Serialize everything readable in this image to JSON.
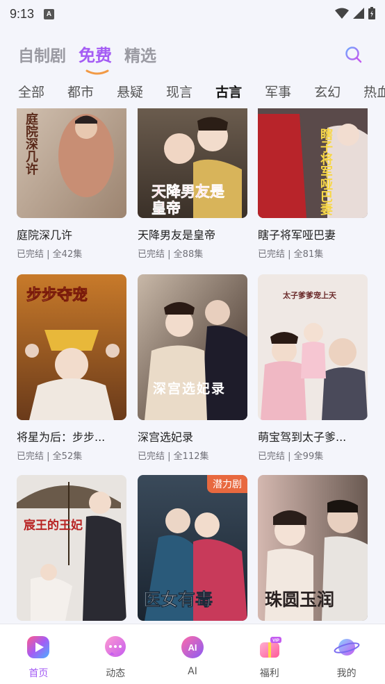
{
  "status": {
    "time": "9:13",
    "notif_letter": "A"
  },
  "top_tabs": [
    {
      "label": "自制剧",
      "active": false
    },
    {
      "label": "免费",
      "active": true
    },
    {
      "label": "精选",
      "active": false
    }
  ],
  "categories": [
    "全部",
    "都市",
    "悬疑",
    "现言",
    "古言",
    "军事",
    "玄幻",
    "热血"
  ],
  "active_category": "古言",
  "dramas": [
    {
      "title": "庭院深几许",
      "status": "已完结",
      "episodes": "全42集",
      "poster_text": "庭院深几许"
    },
    {
      "title": "天降男友是皇帝",
      "status": "已完结",
      "episodes": "全88集",
      "poster_text": "天降男友是皇帝"
    },
    {
      "title": "瞎子将军哑巴妻",
      "status": "已完结",
      "episodes": "全81集",
      "poster_text": "瞎子将军哑巴妻"
    },
    {
      "title": "将星为后：步步...",
      "status": "已完结",
      "episodes": "全52集",
      "poster_text": "步步夺宠"
    },
    {
      "title": "深宫选妃录",
      "status": "已完结",
      "episodes": "全112集",
      "poster_text": "深宫选妃录"
    },
    {
      "title": "萌宝驾到太子爹...",
      "status": "已完结",
      "episodes": "全99集",
      "poster_text": "太子爹爹宠上天"
    },
    {
      "title": "",
      "status": "",
      "episodes": "",
      "poster_text": "宸王的王妃"
    },
    {
      "title": "",
      "status": "",
      "episodes": "",
      "poster_text": "医女有毒",
      "badge": "潜力剧"
    },
    {
      "title": "",
      "status": "",
      "episodes": "",
      "poster_text": "珠圆玉润"
    }
  ],
  "bottom_nav": [
    {
      "label": "首页",
      "icon": "home-play-icon",
      "active": true
    },
    {
      "label": "动态",
      "icon": "chat-bubble-icon",
      "active": false
    },
    {
      "label": "AI",
      "icon": "ai-icon",
      "active": false
    },
    {
      "label": "福利",
      "icon": "gift-vip-icon",
      "active": false
    },
    {
      "label": "我的",
      "icon": "planet-icon",
      "active": false
    }
  ],
  "colors": {
    "accent": "#a45cf4",
    "badge": "#e8693f",
    "background": "#f4f5fb"
  }
}
